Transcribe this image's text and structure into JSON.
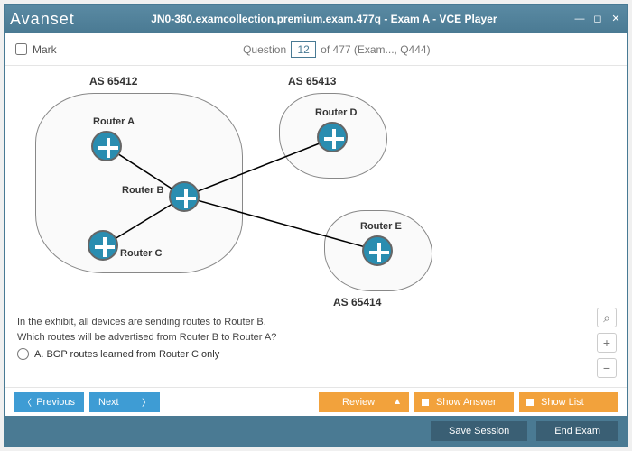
{
  "window": {
    "logo": "Avanset",
    "title": "JN0-360.examcollection.premium.exam.477q - Exam A - VCE Player"
  },
  "header": {
    "mark_label": "Mark",
    "question_word": "Question",
    "current": "12",
    "total_text": "of 477 (Exam..., Q444)"
  },
  "diagram": {
    "as1": "AS 65412",
    "as2": "AS 65413",
    "as3": "AS 65414",
    "routerA": "Router A",
    "routerB": "Router B",
    "routerC": "Router C",
    "routerD": "Router D",
    "routerE": "Router E"
  },
  "question": {
    "stem1": "In the exhibit, all devices are sending routes to Router B.",
    "stem2": "Which routes will be advertised from Router B to Router A?",
    "optA": "A.  BGP routes learned from Router C only"
  },
  "nav": {
    "previous": "Previous",
    "next": "Next",
    "review": "Review",
    "show_answer": "Show Answer",
    "show_list": "Show List"
  },
  "bottom": {
    "save": "Save Session",
    "end": "End Exam"
  }
}
